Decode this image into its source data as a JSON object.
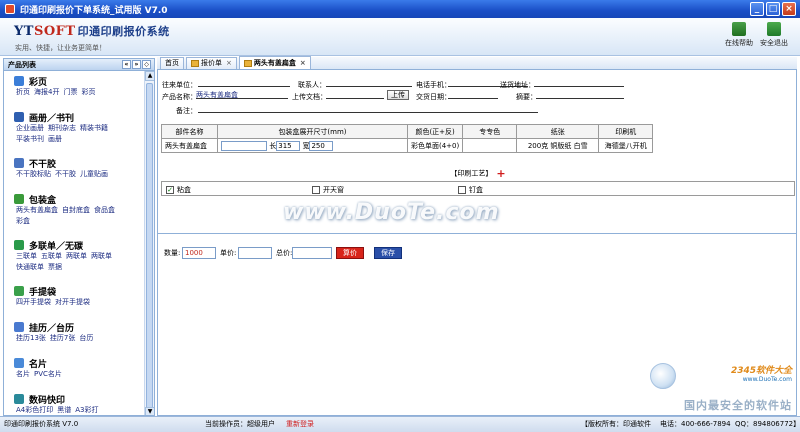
{
  "window": {
    "title": "印通印刷报价下单系统_试用版    V7.0"
  },
  "banner": {
    "logo_yt": "YT",
    "logo_soft": "SOFT",
    "logo_cn": "印通印刷报价系统",
    "slogan": "实用、快捷，让业务更简单！",
    "help_label": "在线帮助",
    "exit_label": "安全退出"
  },
  "sidebar": {
    "header": "产品列表",
    "categories": [
      {
        "title": "彩页",
        "items": [
          "折页",
          "海报4开",
          "门票",
          "彩页"
        ],
        "color": "#3b7ed8"
      },
      {
        "title": "画册／书刊",
        "items": [
          "企业画册",
          "期刊杂志",
          "精装书籍",
          "平装书刊",
          "画册"
        ],
        "color": "#2f5fb0"
      },
      {
        "title": "不干胶",
        "items": [
          "不干胶标贴",
          "不干胶",
          "儿童贴画"
        ],
        "color": "#4a74c0"
      },
      {
        "title": "包装盒",
        "items": [
          "两头有盖扁盒",
          "自封底盒",
          "食品盒",
          "彩盒"
        ],
        "color": "#3a9a3a"
      },
      {
        "title": "多联单／无碳",
        "items": [
          "三联单",
          "五联单",
          "两联单",
          "两联单",
          "快通联单",
          "票据"
        ],
        "color": "#2a9a4a"
      },
      {
        "title": "手提袋",
        "items": [
          "四开手提袋",
          "对开手提袋"
        ],
        "color": "#3aa04a"
      },
      {
        "title": "挂历／台历",
        "items": [
          "挂历13张",
          "挂历7张",
          "台历"
        ],
        "color": "#4a7ad0"
      },
      {
        "title": "名片",
        "items": [
          "名片",
          "PVC名片"
        ],
        "color": "#4a8ad8"
      },
      {
        "title": "数码快印",
        "items": [
          "A4彩色打印",
          "黑谱",
          "A3彩打"
        ],
        "color": "#2a8a9a"
      }
    ]
  },
  "tabs": [
    {
      "label": "首页",
      "closable": false,
      "active": false
    },
    {
      "label": "报价单",
      "closable": true,
      "active": false
    },
    {
      "label": "两头有盖扁盒",
      "closable": true,
      "active": true
    }
  ],
  "form": {
    "customer_label": "往来单位：",
    "contact_label": "联系人：",
    "phone_label": "电话手机：",
    "address_label": "送货地址：",
    "product_label": "产品名称：",
    "product_value": "两头有盖扁盒",
    "upload_label": "上传文档：",
    "upload_button": "上传",
    "delivery_label": "交货日期：",
    "summary_label": "摘要：",
    "remark_label": "备注："
  },
  "table": {
    "headers": [
      "部件名称",
      "包装盒展开尺寸(mm)",
      "颜色(正+反)",
      "专专色",
      "纸张",
      "印刷机"
    ],
    "row": {
      "part": "两头有盖扁盒",
      "len_label": "长",
      "len_value": "315",
      "wid_label": "宽",
      "wid_value": "250",
      "color": "彩色单面(4+0)",
      "paper": "200克 铜版纸 白雪",
      "press": "海德堡八开机"
    }
  },
  "process": {
    "label": "【印刷工艺】",
    "options": [
      {
        "label": "粘盒",
        "checked": true
      },
      {
        "label": "开天窗",
        "checked": false
      },
      {
        "label": "钉盒",
        "checked": false
      }
    ]
  },
  "calc": {
    "qty_label": "数量:",
    "qty_value": "1000",
    "unit_label": "单价:",
    "total_label": "总价:",
    "quote_button": "算价",
    "save_button": "保存"
  },
  "watermark": {
    "text": "www.DuoTe.com"
  },
  "corner_watermark": {
    "brand": "2345软件大全",
    "url": "www.DuoTe.com",
    "slogan": "国内最安全的软件站"
  },
  "status": {
    "app": "印通印刷报价系统 V7.0",
    "operator_label": "当前操作员：超级用户",
    "relogin": "重新登录",
    "copyright": "【版权所有：印通软件",
    "phone": "电话：400-666-7894",
    "qq": "QQ：894806772】"
  }
}
